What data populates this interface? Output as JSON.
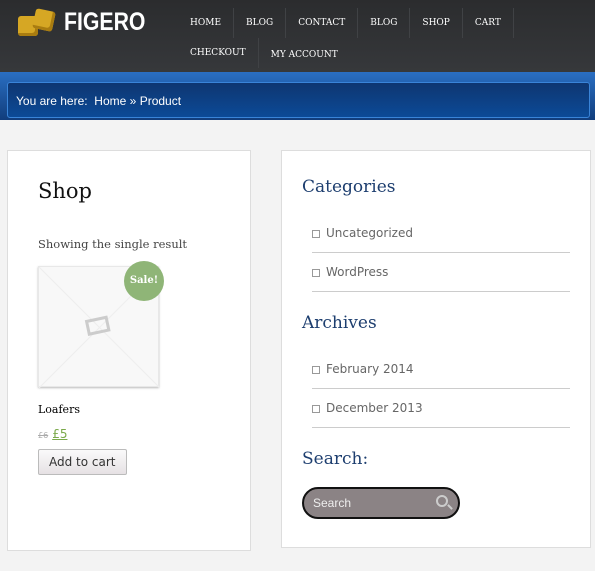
{
  "brand": {
    "name": "FIGERO"
  },
  "nav": [
    "HOME",
    "BLOG",
    "CONTACT",
    "BLOG",
    "SHOP",
    "CART",
    "CHECKOUT",
    "MY ACCOUNT"
  ],
  "breadcrumb": {
    "label": "You are here:",
    "home": "Home",
    "sep": "»",
    "current": "Product"
  },
  "shop": {
    "title": "Shop",
    "result": "Showing the single result",
    "product": {
      "name": "Loafers",
      "badge": "Sale!",
      "old_price": "£6",
      "price": "£5",
      "button": "Add to cart"
    }
  },
  "sidebar": {
    "categories_title": "Categories",
    "categories": [
      "Uncategorized",
      "WordPress"
    ],
    "archives_title": "Archives",
    "archives": [
      "February 2014",
      "December 2013"
    ],
    "search_title": "Search:",
    "search_placeholder": "Search"
  },
  "colors": {
    "accent": "#1d3e6f",
    "sale": "#8fb577",
    "price": "#7aa94a"
  }
}
